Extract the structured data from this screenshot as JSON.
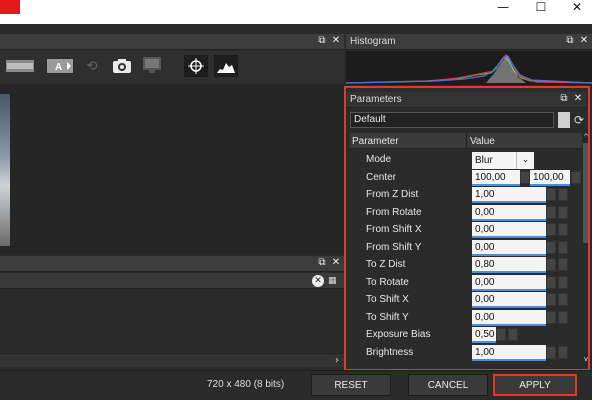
{
  "window": {
    "controls": {
      "minimize": "—",
      "maximize": "☐",
      "close": "✕"
    }
  },
  "toolbar": {
    "icons": [
      "film-strip-icon",
      "text-overlay-icon",
      "sync-icon",
      "camera-icon",
      "monitor-icon",
      "crosshair-icon",
      "histogram-icon"
    ],
    "text_overlay_glyph": "A"
  },
  "histogram": {
    "title": "Histogram"
  },
  "parameters": {
    "title": "Parameters",
    "preset": "Default",
    "headers": {
      "parameter": "Parameter",
      "value": "Value"
    },
    "rows": [
      {
        "name": "Mode",
        "value": "Blur Color"
      },
      {
        "name": "Center",
        "value": "100,00",
        "value2": "100,00"
      },
      {
        "name": "From Z Dist",
        "value": "1,00"
      },
      {
        "name": "From Rotate",
        "value": "0,00"
      },
      {
        "name": "From Shift X",
        "value": "0,00"
      },
      {
        "name": "From Shift Y",
        "value": "0,00"
      },
      {
        "name": "To Z Dist",
        "value": "0,80"
      },
      {
        "name": "To Rotate",
        "value": "0,00"
      },
      {
        "name": "To Shift X",
        "value": "0,00"
      },
      {
        "name": "To Shift Y",
        "value": "0,00"
      },
      {
        "name": "Exposure Bias",
        "value": "0,50"
      },
      {
        "name": "Brightness",
        "value": "1,00"
      }
    ]
  },
  "status": {
    "resolution": "720 x 480 (8 bits)"
  },
  "buttons": {
    "reset": "RESET",
    "cancel": "CANCEL",
    "apply": "APPLY"
  },
  "colors": {
    "highlight": "#e03a2a",
    "accent": "#4a8fdc"
  }
}
